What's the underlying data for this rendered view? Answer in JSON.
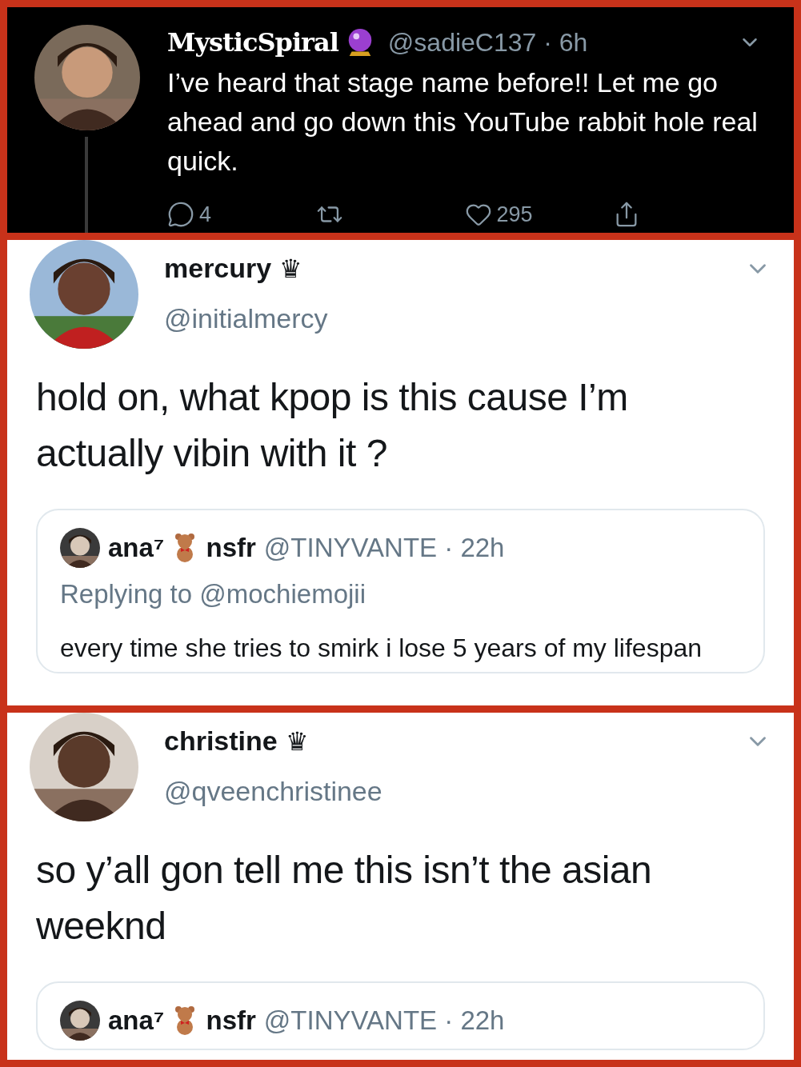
{
  "tweets": [
    {
      "kind": "thread-reply",
      "name": "MysticSpiral",
      "handle_line": "@sadieC137 · 6h",
      "text": "I’ve heard that stage name before!! Let me go ahead and go down this YouTube rabbit hole real quick.",
      "actions": [
        {
          "kind": "reply",
          "count": "4"
        },
        {
          "kind": "retweet"
        },
        {
          "kind": "like",
          "count": "295"
        },
        {
          "kind": "share"
        }
      ]
    },
    {
      "kind": "quote",
      "name": "mercury",
      "name_mark": "♛",
      "handle": "@initialmercy",
      "text": "hold on, what kpop is this cause I’m actually vibin with it ?",
      "quoted": {
        "name": "ana⁷",
        "name_suffix": "nsfr",
        "handle_line": "@TINYVANTE · 22h",
        "replying_to": "Replying to @mochiemojii",
        "text": "every time she tries to smirk i lose 5 years of my lifespan"
      }
    },
    {
      "kind": "quote",
      "name": "christine",
      "name_mark": "♛",
      "handle": "@qveenchristinee",
      "text": "so y’all gon tell me this isn’t the asian weeknd",
      "quoted": {
        "name": "ana⁷",
        "name_suffix": "nsfr",
        "handle_line": "@TINYVANTE · 22h"
      }
    }
  ]
}
